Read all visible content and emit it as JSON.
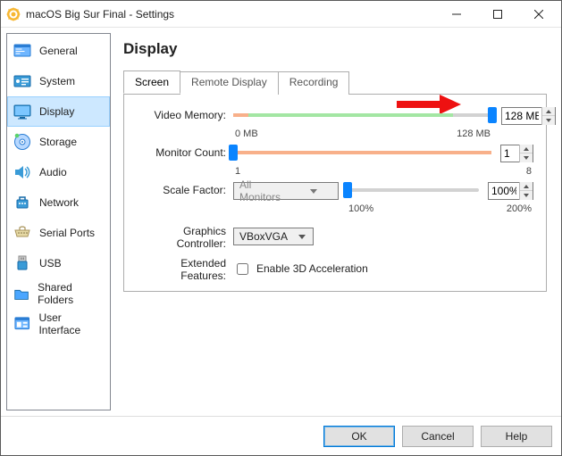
{
  "window": {
    "title": "macOS Big Sur Final - Settings"
  },
  "sidebar": {
    "items": [
      {
        "label": "General"
      },
      {
        "label": "System"
      },
      {
        "label": "Display"
      },
      {
        "label": "Storage"
      },
      {
        "label": "Audio"
      },
      {
        "label": "Network"
      },
      {
        "label": "Serial Ports"
      },
      {
        "label": "USB"
      },
      {
        "label": "Shared Folders"
      },
      {
        "label": "User Interface"
      }
    ],
    "selected_index": 2
  },
  "page": {
    "title": "Display"
  },
  "tabs": {
    "items": [
      {
        "label": "Screen"
      },
      {
        "label": "Remote Display"
      },
      {
        "label": "Recording"
      }
    ],
    "active_index": 0
  },
  "screen": {
    "video_memory": {
      "label": "Video Memory:",
      "value_text": "128 MB",
      "min_text": "0 MB",
      "max_text": "128 MB",
      "thumb_pct": 100,
      "orange_pct": 6,
      "green_start_pct": 6,
      "green_end_pct": 85
    },
    "monitor_count": {
      "label": "Monitor Count:",
      "value_text": "1",
      "min_text": "1",
      "max_text": "8",
      "thumb_pct": 0,
      "orange_pct": 100
    },
    "scale_factor": {
      "label": "Scale Factor:",
      "combo_text": "All Monitors",
      "value_text": "100%",
      "min_text": "100%",
      "max_text": "200%",
      "thumb_pct": 0
    },
    "graphics_controller": {
      "label": "Graphics Controller:",
      "combo_text": "VBoxVGA"
    },
    "extended_features": {
      "label": "Extended Features:",
      "check_label": "Enable 3D Acceleration"
    }
  },
  "footer": {
    "ok": "OK",
    "cancel": "Cancel",
    "help": "Help"
  }
}
